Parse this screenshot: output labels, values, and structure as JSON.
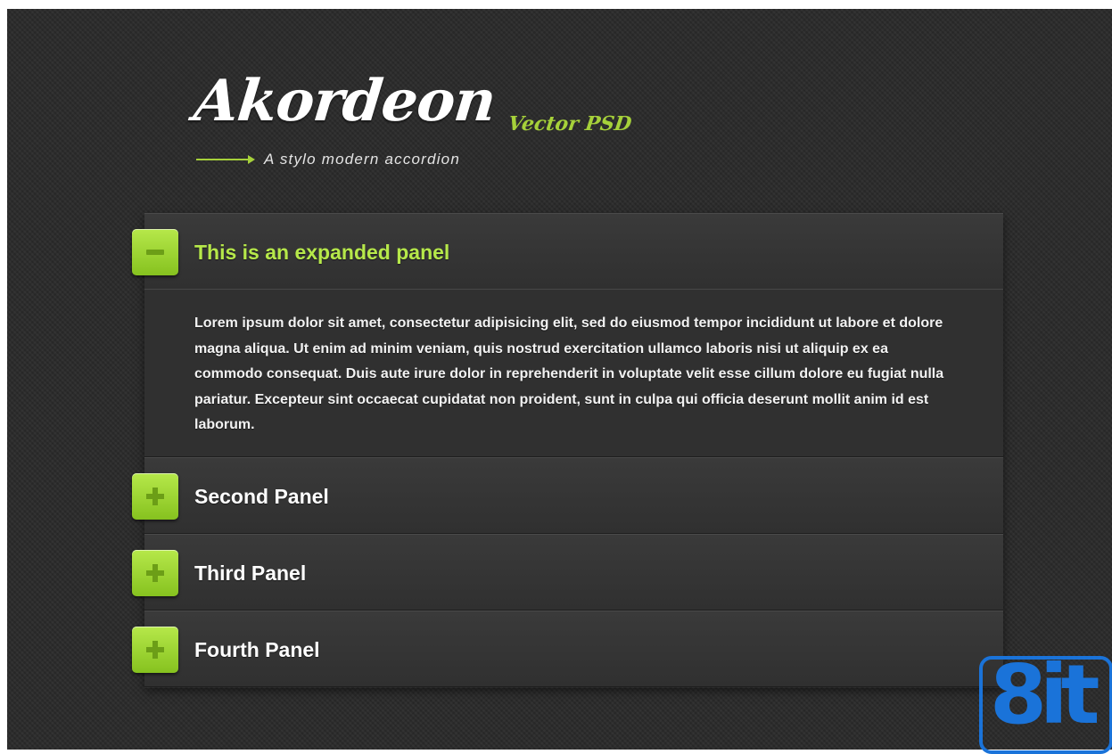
{
  "header": {
    "logo_title": "Akordeon",
    "logo_badge": "Vector PSD",
    "tagline": "A stylo modern accordion"
  },
  "accordion": {
    "panels": [
      {
        "title": "This is an expanded panel",
        "expanded": true,
        "toggle_icon": "minus-icon",
        "body": "Lorem ipsum dolor sit amet, consectetur adipisicing elit, sed do eiusmod tempor incididunt ut labore et dolore magna aliqua. Ut enim ad minim veniam, quis nostrud exercitation ullamco laboris nisi ut aliquip ex ea commodo consequat. Duis aute irure dolor in reprehenderit in voluptate velit esse cillum dolore eu fugiat nulla pariatur. Excepteur sint occaecat cupidatat non proident, sunt in culpa qui officia deserunt mollit anim id est laborum."
      },
      {
        "title": "Second Panel",
        "expanded": false,
        "toggle_icon": "plus-icon"
      },
      {
        "title": "Third Panel",
        "expanded": false,
        "toggle_icon": "plus-icon"
      },
      {
        "title": "Fourth Panel",
        "expanded": false,
        "toggle_icon": "plus-icon"
      }
    ]
  },
  "watermark": {
    "text": "8it"
  },
  "colors": {
    "accent": "#a6d13a",
    "background": "#2a2a2a",
    "panel": "#333333",
    "watermark": "#1a73d9"
  }
}
